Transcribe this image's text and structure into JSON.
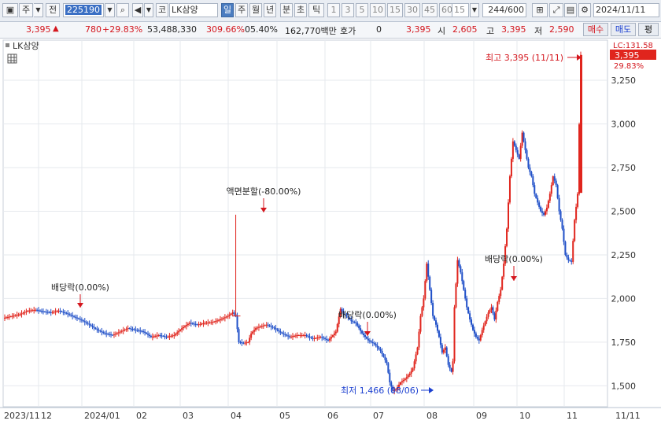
{
  "toolbar": {
    "mode": "주",
    "scope": "전",
    "code": "225190",
    "market": "코",
    "name": "LK삼양",
    "periods": [
      "일",
      "주",
      "월",
      "년",
      "분",
      "초",
      "틱"
    ],
    "active_period": "일",
    "numbers": [
      "1",
      "3",
      "5",
      "10",
      "15",
      "30",
      "45",
      "60"
    ],
    "interval": "15",
    "count": "244/600",
    "date": "2024/11/11"
  },
  "quote": {
    "price": "3,395",
    "change": "780",
    "change_pct": "+29.83%",
    "volume": "53,488,330",
    "volume_ratio": "309.66%",
    "turnover": "05.40%",
    "amount": "162,770백만",
    "hoga_label": "호가",
    "hoga_value": "0",
    "hoga_price": "3,395",
    "open_label": "시",
    "open": "2,605",
    "high_label": "고",
    "high": "3,395",
    "low_label": "저",
    "low": "2,590",
    "buy_label": "매수",
    "sell_label": "매도",
    "avg_label": "평"
  },
  "chart_data": {
    "type": "candlestick",
    "title": "LK삼양",
    "x_labels": [
      "2023/11",
      "12",
      "2024/01",
      "02",
      "03",
      "04",
      "05",
      "06",
      "07",
      "08",
      "09",
      "10",
      "11",
      "11/11"
    ],
    "y_ticks": [
      1500,
      1750,
      2000,
      2250,
      2500,
      2750,
      3000,
      3250
    ],
    "ylim": [
      1380,
      3480
    ],
    "grid": true,
    "current_price_label": "3,395",
    "current_change_label": "29.83%",
    "lc_label": "LC:131.58",
    "annotations": [
      {
        "text": "배당락(0.00%)",
        "date": "2023/12/27"
      },
      {
        "text": "액면분할(-80.00%)",
        "date": "2024/04/15"
      },
      {
        "text": "배당락(0.00%)",
        "date": "2024/06/27"
      },
      {
        "text": "배당락(0.00%)",
        "date": "2024/09/26"
      },
      {
        "text": "최고 3,395 (11/11)",
        "value": 3395,
        "date": "2024/11/11"
      },
      {
        "text": "최저 1,466 (08/06)",
        "value": 1466,
        "date": "2024/08/06"
      }
    ],
    "close_path": [
      [
        0,
        1890
      ],
      [
        5,
        1900
      ],
      [
        10,
        1910
      ],
      [
        15,
        1930
      ],
      [
        20,
        1935
      ],
      [
        25,
        1925
      ],
      [
        30,
        1920
      ],
      [
        35,
        1930
      ],
      [
        40,
        1915
      ],
      [
        45,
        1895
      ],
      [
        50,
        1875
      ],
      [
        55,
        1850
      ],
      [
        60,
        1820
      ],
      [
        65,
        1800
      ],
      [
        70,
        1790
      ],
      [
        75,
        1810
      ],
      [
        80,
        1830
      ],
      [
        85,
        1820
      ],
      [
        90,
        1810
      ],
      [
        95,
        1780
      ],
      [
        100,
        1790
      ],
      [
        105,
        1780
      ],
      [
        110,
        1790
      ],
      [
        115,
        1830
      ],
      [
        120,
        1860
      ],
      [
        125,
        1850
      ],
      [
        130,
        1860
      ],
      [
        135,
        1865
      ],
      [
        140,
        1880
      ],
      [
        145,
        1900
      ],
      [
        148,
        1920
      ],
      [
        150,
        1900
      ],
      [
        152,
        1750
      ],
      [
        155,
        1745
      ],
      [
        158,
        1750
      ],
      [
        160,
        1800
      ],
      [
        163,
        1830
      ],
      [
        166,
        1840
      ],
      [
        170,
        1850
      ],
      [
        175,
        1830
      ],
      [
        180,
        1800
      ],
      [
        185,
        1780
      ],
      [
        190,
        1790
      ],
      [
        195,
        1790
      ],
      [
        200,
        1770
      ],
      [
        205,
        1780
      ],
      [
        210,
        1760
      ],
      [
        212,
        1780
      ],
      [
        215,
        1810
      ],
      [
        218,
        1940
      ],
      [
        220,
        1910
      ],
      [
        222,
        1900
      ],
      [
        225,
        1870
      ],
      [
        228,
        1860
      ],
      [
        232,
        1800
      ],
      [
        236,
        1760
      ],
      [
        240,
        1740
      ],
      [
        244,
        1700
      ],
      [
        248,
        1630
      ],
      [
        250,
        1520
      ],
      [
        252,
        1470
      ],
      [
        254,
        1480
      ],
      [
        257,
        1520
      ],
      [
        260,
        1540
      ],
      [
        263,
        1570
      ],
      [
        265,
        1600
      ],
      [
        268,
        1720
      ],
      [
        270,
        1900
      ],
      [
        272,
        2000
      ],
      [
        274,
        2200
      ],
      [
        276,
        2050
      ],
      [
        278,
        1900
      ],
      [
        280,
        1850
      ],
      [
        282,
        1780
      ],
      [
        284,
        1690
      ],
      [
        286,
        1720
      ],
      [
        288,
        1620
      ],
      [
        290,
        1580
      ],
      [
        291,
        1640
      ],
      [
        292,
        1950
      ],
      [
        294,
        2220
      ],
      [
        296,
        2150
      ],
      [
        298,
        2050
      ],
      [
        300,
        1950
      ],
      [
        302,
        1880
      ],
      [
        304,
        1820
      ],
      [
        306,
        1780
      ],
      [
        308,
        1760
      ],
      [
        310,
        1820
      ],
      [
        312,
        1870
      ],
      [
        314,
        1920
      ],
      [
        316,
        1950
      ],
      [
        318,
        1880
      ],
      [
        320,
        1980
      ],
      [
        322,
        2050
      ],
      [
        324,
        2200
      ],
      [
        326,
        2400
      ],
      [
        328,
        2700
      ],
      [
        330,
        2900
      ],
      [
        332,
        2850
      ],
      [
        334,
        2800
      ],
      [
        336,
        2950
      ],
      [
        338,
        2850
      ],
      [
        340,
        2750
      ],
      [
        342,
        2700
      ],
      [
        344,
        2600
      ],
      [
        346,
        2550
      ],
      [
        348,
        2500
      ],
      [
        350,
        2480
      ],
      [
        352,
        2520
      ],
      [
        354,
        2600
      ],
      [
        356,
        2700
      ],
      [
        358,
        2650
      ],
      [
        360,
        2500
      ],
      [
        362,
        2400
      ],
      [
        364,
        2250
      ],
      [
        366,
        2220
      ],
      [
        368,
        2210
      ],
      [
        370,
        2450
      ],
      [
        372,
        2600
      ],
      [
        374,
        3395
      ]
    ],
    "volume_pct_label": "309.66%"
  }
}
